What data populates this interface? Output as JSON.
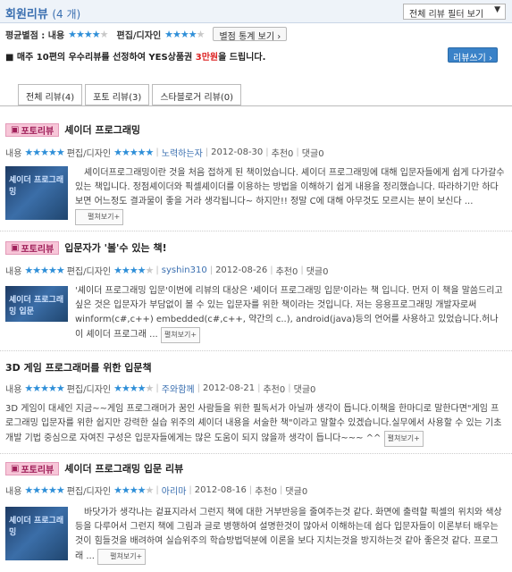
{
  "header": {
    "title": "회원리뷰",
    "count": "(4 개)",
    "filter_select": "전체 리뷰 필터 보기",
    "filter_arrow": "▼"
  },
  "summary": {
    "label": "평균별점 : 내용",
    "content_stars": "★★★★",
    "content_off": "★",
    "editing_label": "편집/디자인",
    "editing_stars": "★★★★",
    "editing_off": "★",
    "stats_button": "별점 통계 보기 ›"
  },
  "notice": {
    "prefix": "■ 매주 10편의 우수리뷰를 선정하여 YES상품권 ",
    "highlight": "3만원",
    "suffix": "을 드립니다.",
    "write_button": "리뷰쓰기 ›"
  },
  "tabs": [
    {
      "label": "전체 리뷰(4)"
    },
    {
      "label": "포토 리뷰(3)"
    },
    {
      "label": "스타블로거 리뷰(0)"
    }
  ],
  "reviews": [
    {
      "badge": "포토리뷰",
      "title": "셰이더 프로그래밍",
      "content_label": "내용",
      "content_stars": "★★★★★",
      "content_off": "",
      "edit_label": "편집/디자인",
      "edit_stars": "★★★★★",
      "edit_off": "",
      "user": "노력하는자",
      "date": "2012-08-30",
      "recommend": "추천0",
      "comments": "댓글0",
      "thumb_text": "셰이더 프로그래밍",
      "text": "셰이더프로그래밍이란 것을 처음 접하게 된 책이었습니다. 셰이더 프로그래밍에 대해 입문자들에게 쉽게 다가갈수있는 책입니다. 정점셰이더와 픽셀셰이더를 이용하는 방법을 이해하기 쉽게 내용을 정리했습니다. 따라하기만 하다보면 어느정도 결과물이 좋을 거라 생각됩니다~ 하지만!! 정말 C에 대해 아무것도 모르시는 분이 보신다 ...",
      "more": "펼쳐보기+"
    },
    {
      "badge": "포토리뷰",
      "title": "입문자가 '볼'수 있는 책!",
      "content_label": "내용",
      "content_stars": "★★★★★",
      "content_off": "",
      "edit_label": "편집/디자인",
      "edit_stars": "★★★★",
      "edit_off": "★",
      "user": "syshin310",
      "date": "2012-08-26",
      "recommend": "추천0",
      "comments": "댓글0",
      "thumb_text": "셰이더 프로그래밍 입문",
      "text": "'셰이더 프로그래밍 입문'이번에 리뷰의 대상은 '셰이더 프로그래밍 입문'이라는 책 입니다. 먼저 이 책을 말씀드리고 싶은 것은 입문자가 부담없이 볼 수 있는 입문자를 위한 책이라는 것입니다. 저는 응용프로그래밍 개발자로써 winform(c#,c++) embedded(c#,c++, 약간의 c..), android(java)등의 언어를 사용하고 있었습니다.허나 이 셰이더 프로그래 ...",
      "more": "펼쳐보기+"
    },
    {
      "badge": "",
      "title": "3D 게임 프로그래머를 위한 입문책",
      "content_label": "내용",
      "content_stars": "★★★★★",
      "content_off": "",
      "edit_label": "편집/디자인",
      "edit_stars": "★★★★",
      "edit_off": "★",
      "user": "주와함께",
      "date": "2012-08-21",
      "recommend": "추천0",
      "comments": "댓글0",
      "thumb_text": "",
      "text": "3D 게임이 대세인 지금~~게임 프로그래머가 꿈인 사람들을 위한 필독서가 아닐까 생각이 듭니다.이책을 한마디로 말한다면\"게임 프로그래밍 입문자를 위한 쉽지만 강력한 실습 위주의 셰이더 내용을 서술한 책\"이라고 말할수 있겠습니다.실무에서 사용할 수 있는 기초 개발 기법 중심으로 자여진 구성은 입문자들에게는 많은 도움이 되지 않을까 생각이 듭니다~~~ ^^",
      "more": "펼쳐보기+"
    },
    {
      "badge": "포토리뷰",
      "title": "셰이더 프로그래밍 입문 리뷰",
      "content_label": "내용",
      "content_stars": "★★★★★",
      "content_off": "",
      "edit_label": "편집/디자인",
      "edit_stars": "★★★★",
      "edit_off": "★",
      "user": "아리마",
      "date": "2012-08-16",
      "recommend": "추천0",
      "comments": "댓글0",
      "thumb_text": "셰이더 프로그래밍",
      "text": "바닷가가 생각나는 겉표지라서 그런지 책에 대한 거부반응을 줄여주는것 같다. 화면에 출력할 픽셀의 위치와 색상등을 다루어서 그런지 책에 그림과 글로 병행하여 설명한것이 많아서 이해하는데 쉽다 입문자들이 이론부터 배우는것이 힘들것을 배려하여 실습위주의 학습방법덕분에 이론을 보다 지치는것을 방지하는것 같아 좋은것 같다. 프로그래 ...",
      "more": "펼쳐보기+"
    }
  ]
}
